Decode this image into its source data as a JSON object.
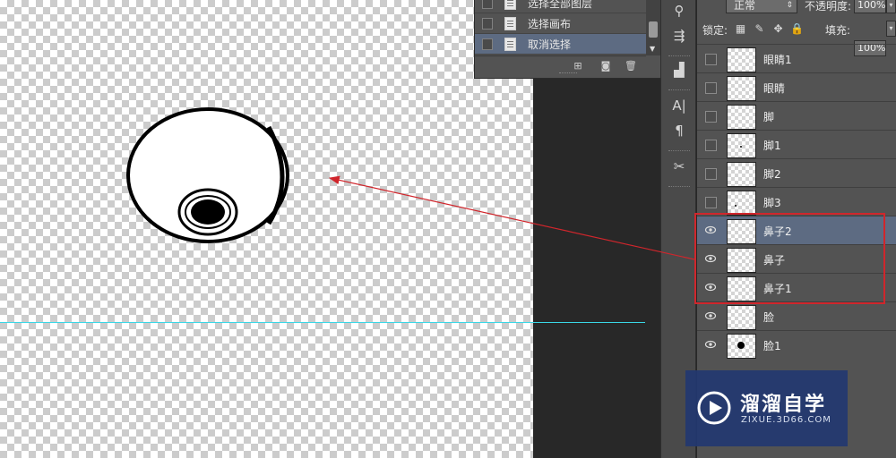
{
  "history": {
    "items": [
      {
        "label": "选择全部图层",
        "selected": false
      },
      {
        "label": "选择画布",
        "selected": false
      },
      {
        "label": "取消选择",
        "selected": true
      }
    ]
  },
  "layers_panel": {
    "blend_mode": "正常",
    "opacity_label": "不透明度:",
    "opacity_value": "100%",
    "lock_label": "锁定:",
    "fill_label": "填充:",
    "fill_value": "100%",
    "layers": [
      {
        "name": "眼睛1",
        "visible": false,
        "selected": false
      },
      {
        "name": "眼睛",
        "visible": false,
        "selected": false
      },
      {
        "name": "脚",
        "visible": false,
        "selected": false
      },
      {
        "name": "脚1",
        "visible": false,
        "selected": false
      },
      {
        "name": "脚2",
        "visible": false,
        "selected": false
      },
      {
        "name": "脚3",
        "visible": false,
        "selected": false
      },
      {
        "name": "鼻子2",
        "visible": true,
        "selected": true
      },
      {
        "name": "鼻子",
        "visible": true,
        "selected": false
      },
      {
        "name": "鼻子1",
        "visible": true,
        "selected": false
      },
      {
        "name": "脸",
        "visible": true,
        "selected": false
      },
      {
        "name": "脸1",
        "visible": true,
        "selected": false
      }
    ]
  },
  "tool_strip": {
    "text_tool": "A|",
    "paragraph_tool": "¶"
  },
  "watermark": {
    "title": "溜溜自学",
    "subtitle": "ZIXUE.3D66.COM"
  },
  "colors": {
    "guide": "#3ad7e6",
    "annotation": "#d0262c",
    "selected_row": "#5d6b82",
    "panel_bg": "#535353"
  }
}
